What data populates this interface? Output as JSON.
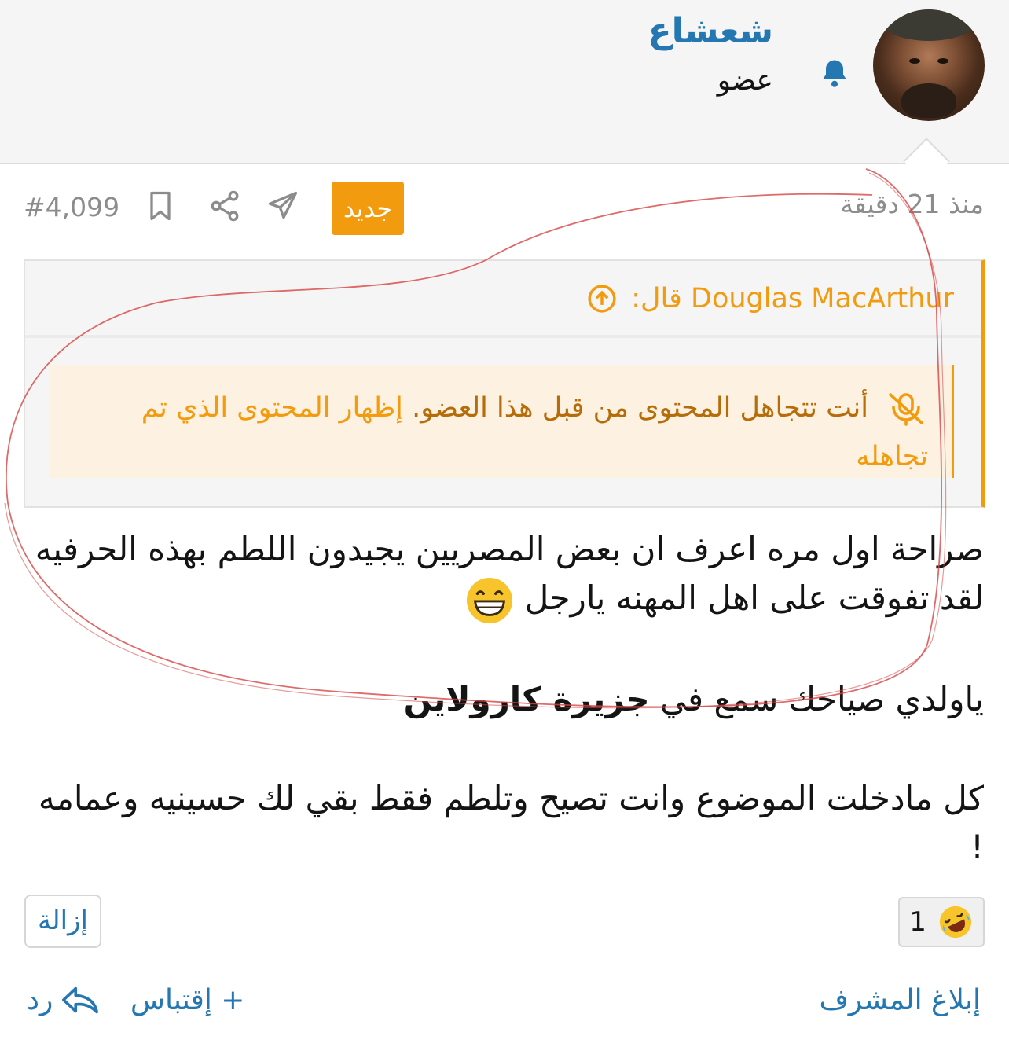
{
  "user": {
    "name": "شعشاع",
    "title": "عضو"
  },
  "post": {
    "time": "منذ 21 دقيقة",
    "new_badge": "جديد",
    "number": "#4,099"
  },
  "quote": {
    "author_line": "Douglas MacArthur قال:",
    "ignored_text": "أنت تتجاهل المحتوى من قبل هذا العضو.",
    "show_ignored_link": "إظهار المحتوى الذي تم تجاهله"
  },
  "body": {
    "paragraph1": "صراحة اول مره اعرف ان بعض المصريين يجيدون اللطم بهذه الحرفيه لقد تفوقت على اهل المهنه يارجل",
    "paragraph2_prefix": "ياولدي صياحك سمع في",
    "paragraph2_bold": "جزيرة كارولاين",
    "paragraph3": "كل مادخلت الموضوع وانت تصيح وتلطم فقط بقي لك حسينيه وعمامه !"
  },
  "reactions": {
    "count": "1",
    "icon": "rofl-emoji"
  },
  "actions": {
    "remove": "إزالة",
    "report": "إبلاغ المشرف",
    "quote": "+ إقتباس",
    "reply": "رد"
  },
  "colors": {
    "link_blue": "#2577b1",
    "accent_orange": "#f29b0e",
    "muted_gray": "#8c8c8c",
    "annotation_red": "#d64545"
  }
}
